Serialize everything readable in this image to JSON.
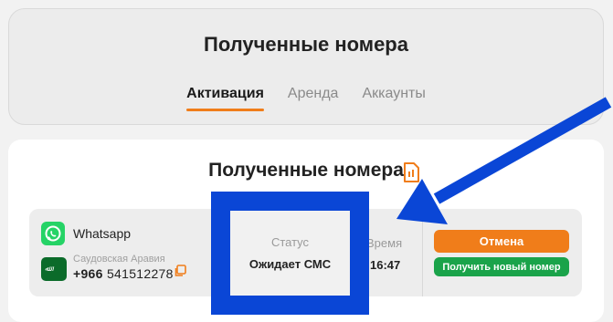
{
  "header": {
    "title": "Полученные номера",
    "tabs": [
      {
        "label": "Активация",
        "active": true
      },
      {
        "label": "Аренда",
        "active": false
      },
      {
        "label": "Аккаунты",
        "active": false
      }
    ]
  },
  "section": {
    "title": "Полученные номера"
  },
  "order": {
    "service": "Whatsapp",
    "country": "Саудовская Аравия",
    "country_flag_text": "ﷲ",
    "phone_code": "+966",
    "phone_number": "541512278",
    "status_label": "Статус",
    "status_value": "Ожидает СМС",
    "time_label": "Время",
    "time_value": "16:47",
    "cancel_label": "Отмена",
    "new_number_label": "Получить новый номер"
  },
  "colors": {
    "accent": "#f07d1a",
    "success": "#1aa34a",
    "highlight": "#0a46d6"
  }
}
